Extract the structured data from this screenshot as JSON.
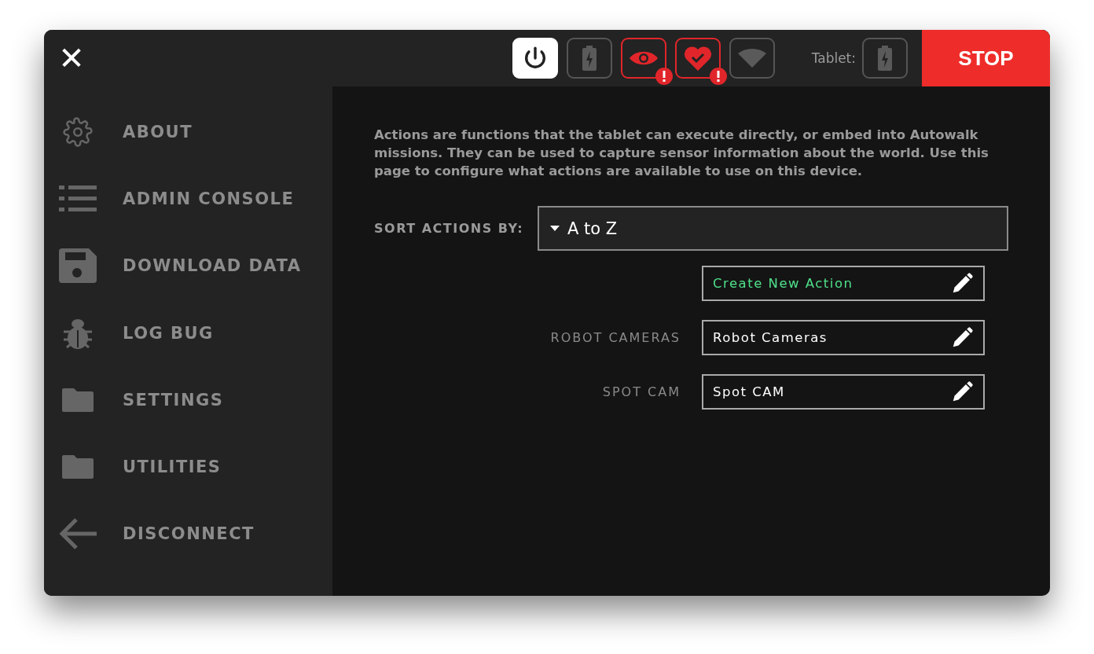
{
  "topbar": {
    "close": "✕",
    "status_icons": [
      {
        "kind": "power",
        "active": true,
        "alert": false
      },
      {
        "kind": "battery",
        "active": false,
        "alert": false
      },
      {
        "kind": "eye",
        "active": false,
        "alert": true
      },
      {
        "kind": "heart",
        "active": false,
        "alert": true
      },
      {
        "kind": "wifi",
        "active": false,
        "alert": false
      }
    ],
    "tablet_label": "Tablet:",
    "stop": "STOP"
  },
  "sidebar": {
    "items": [
      {
        "kind": "gear",
        "label": "ABOUT"
      },
      {
        "kind": "list",
        "label": "ADMIN CONSOLE"
      },
      {
        "kind": "disk",
        "label": "DOWNLOAD DATA"
      },
      {
        "kind": "bug",
        "label": "LOG BUG"
      },
      {
        "kind": "folder",
        "label": "SETTINGS"
      },
      {
        "kind": "folder",
        "label": "UTILITIES"
      },
      {
        "kind": "back",
        "label": "DISCONNECT"
      }
    ]
  },
  "content": {
    "description": "Actions are functions that the tablet can execute directly, or embed into Autowalk missions. They can be used to capture sensor information about the world. Use this page to configure what actions are available to use on this device.",
    "sort": {
      "label": "SORT ACTIONS BY:",
      "value": "A to Z"
    },
    "actions": [
      {
        "kind": "create",
        "name": "Create New Action"
      },
      {
        "kind": "action",
        "label": "ROBOT CAMERAS",
        "name": "Robot Cameras"
      },
      {
        "kind": "action",
        "label": "SPOT CAM",
        "name": "Spot CAM"
      }
    ]
  }
}
